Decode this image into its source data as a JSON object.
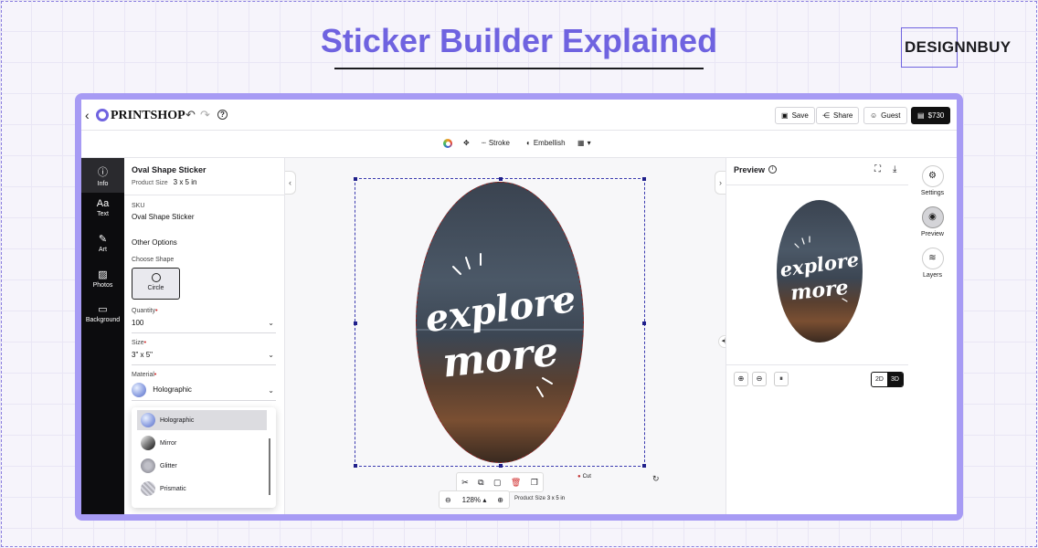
{
  "banner": {
    "headline": "Sticker Builder Explained",
    "logo": "DESIGNNBUY"
  },
  "topbar": {
    "back_icon": "chevron-left-icon",
    "brand": "PRINTSHOP",
    "save": "Save",
    "share": "Share",
    "guest": "Guest",
    "cart": "$730"
  },
  "formatbar": {
    "stroke": "Stroke",
    "embellish": "Embellish"
  },
  "leftnav": [
    {
      "label": "Info",
      "icon": "info-icon"
    },
    {
      "label": "Text",
      "icon": "text-icon"
    },
    {
      "label": "Art",
      "icon": "art-icon"
    },
    {
      "label": "Photos",
      "icon": "photos-icon"
    },
    {
      "label": "Background",
      "icon": "background-icon"
    }
  ],
  "panel": {
    "title": "Oval Shape Sticker",
    "product_size_label": "Product Size",
    "product_size_value": "3 x 5 in",
    "sku_label": "SKU",
    "sku_value": "Oval Shape Sticker",
    "other_options": "Other Options",
    "choose_shape": "Choose Shape",
    "shape_option": "Circle",
    "quantity_label": "Quantity",
    "quantity_value": "100",
    "size_label": "Size",
    "size_value": "3\" x 5\"",
    "material_label": "Material",
    "material_value": "Holographic",
    "material_options": [
      "Holographic",
      "Mirror",
      "Glitter",
      "Prismatic"
    ]
  },
  "canvas": {
    "sticker_text_line1": "explore",
    "sticker_text_line2": "more",
    "cut_label": "Cut",
    "zoom_value": "128%",
    "product_size_label": "Product Size",
    "product_size_value": "3 x 5 in"
  },
  "preview": {
    "title": "Preview",
    "mode_2d": "2D",
    "mode_3d": "3D",
    "active_mode": "3D"
  },
  "rail": [
    {
      "label": "Settings",
      "icon": "gear-icon"
    },
    {
      "label": "Preview",
      "icon": "eye-icon"
    },
    {
      "label": "Layers",
      "icon": "layers-icon"
    }
  ],
  "colors": {
    "accent": "#6f63e0",
    "frame": "#a79bf4",
    "nav_bg": "#0c0c0e",
    "required": "#d02020"
  }
}
